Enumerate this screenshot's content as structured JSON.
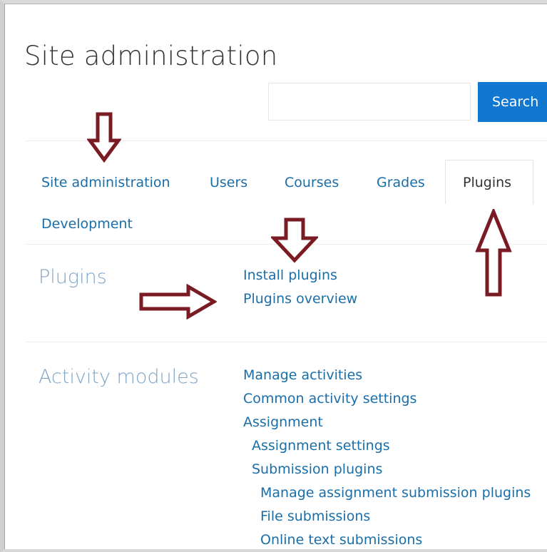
{
  "header": {
    "title": "Site administration",
    "search": {
      "placeholder": "",
      "value": "",
      "button_label": "Search"
    }
  },
  "tabs": [
    {
      "label": "Site administration",
      "active": false
    },
    {
      "label": "Users",
      "active": false
    },
    {
      "label": "Courses",
      "active": false
    },
    {
      "label": "Grades",
      "active": false
    },
    {
      "label": "Plugins",
      "active": true
    },
    {
      "label": "Development",
      "active": false
    }
  ],
  "sections": {
    "plugins": {
      "title": "Plugins",
      "links": [
        "Install plugins",
        "Plugins overview"
      ]
    },
    "activity_modules": {
      "title": "Activity modules",
      "links": [
        "Manage activities",
        "Common activity settings",
        "Assignment",
        "Assignment settings",
        "Submission plugins",
        "Manage assignment submission plugins",
        "File submissions",
        "Online text submissions"
      ]
    }
  },
  "annotations": {
    "arrow_color": "#7a1a22",
    "arrows": [
      "down",
      "down",
      "right",
      "up"
    ]
  },
  "colors": {
    "link": "#1a6ea8",
    "section_title": "#7fa4c6",
    "search_button": "#1177d1"
  }
}
